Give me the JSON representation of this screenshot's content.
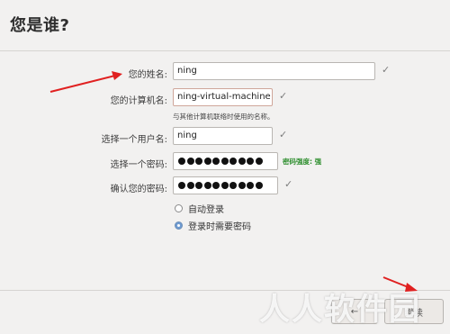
{
  "header": {
    "title": "您是谁?"
  },
  "form": {
    "name": {
      "label": "您的姓名:",
      "value": "ning"
    },
    "computer": {
      "label": "您的计算机名:",
      "value": "ning-virtual-machine",
      "hint": "与其他计算机联络时使用的名称。"
    },
    "username": {
      "label": "选择一个用户名:",
      "value": "ning"
    },
    "password": {
      "label": "选择一个密码:",
      "dots": 10,
      "strength": "密码强度: 强"
    },
    "confirm": {
      "label": "确认您的密码:",
      "dots": 10
    }
  },
  "login": {
    "options": [
      {
        "label": "自动登录",
        "selected": false
      },
      {
        "label": "登录时需要密码",
        "selected": true
      }
    ]
  },
  "footer": {
    "back_label": "←",
    "continue_label": "继续"
  },
  "icons": {
    "check": "checkmark-icon",
    "arrow": "red-arrow-annotation"
  },
  "colors": {
    "annotation": "#e02020",
    "strength": "#2f8f2f",
    "radio_selected": "#6f9bd1"
  },
  "watermark": "人人软件园"
}
